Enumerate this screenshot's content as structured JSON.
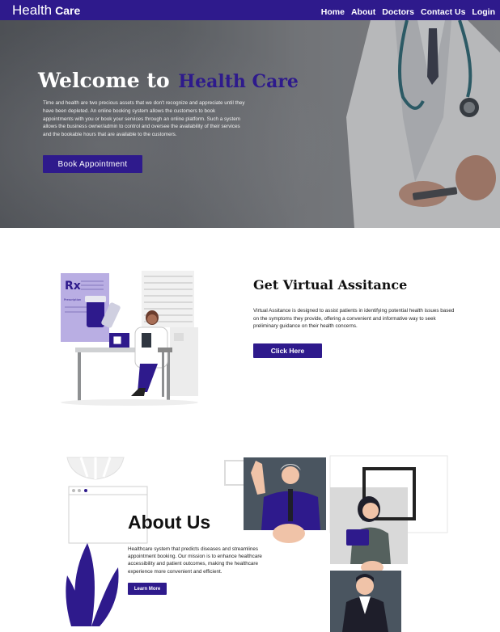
{
  "colors": {
    "brand": "#2e1a8c",
    "nav_text": "#ffffff"
  },
  "nav": {
    "brand_part1": "Health",
    "brand_part2": "Care",
    "links": [
      "Home",
      "About",
      "Doctors",
      "Contact Us",
      "Login"
    ]
  },
  "hero": {
    "title_part1": "Welcome to",
    "title_part2": "Health Care",
    "text": "Time and health are two precious assets that we don't recognize and appreciate until they have been depleted. An online booking system allows the customers to book appointments with you or book your services through an online platform. Such a system allows the business owner/admin to control and oversee the availability of their services and the bookable hours that are available to the customers.",
    "button_label": "Book Appointment"
  },
  "virtual": {
    "title": "Get Virtual Assitance",
    "text": "Virtual Assitance is designed to assist patients in identifying potential health issues based on the symptoms they provide, offering a convenient and informative way to seek preliminary guidance on their health concerns.",
    "button_label": "Click Here",
    "prescription_label": "Prescription"
  },
  "about": {
    "title": "About Us",
    "text": "Healthcare system that predicts diseases and streamlines appointment booking. Our mission is to enhance healthcare accessibility and patient outcomes, making the healthcare experience more convenient and efficient.",
    "button_label": "Learn More"
  }
}
